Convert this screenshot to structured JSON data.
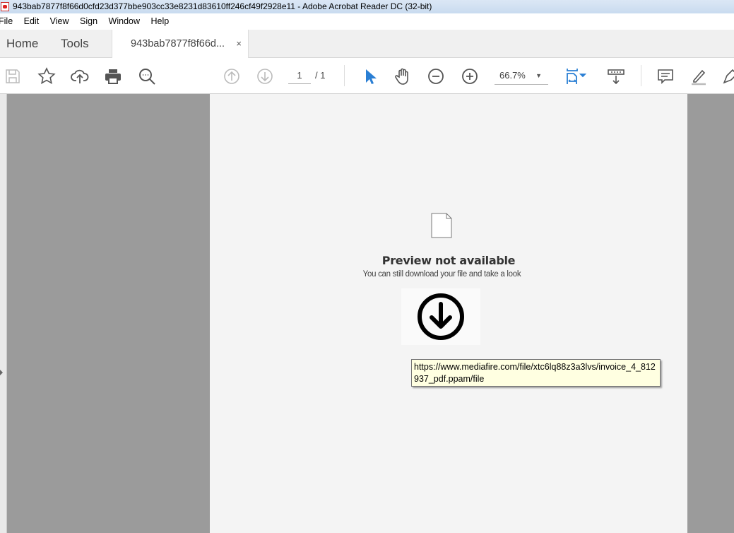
{
  "window": {
    "title": "943bab7877f8f66d0cfd23d377bbe903cc33e8231d83610ff246cf49f2928e11 - Adobe Acrobat Reader DC (32-bit)"
  },
  "menu": [
    "File",
    "Edit",
    "View",
    "Sign",
    "Window",
    "Help"
  ],
  "tabs": {
    "home": "Home",
    "tools": "Tools",
    "document": "943bab7877f8f66d...",
    "close": "×"
  },
  "toolbar": {
    "page_current": "1",
    "page_total": "/ 1",
    "zoom": "66.7%",
    "zoom_caret": "▼",
    "accent": "#2a7fd4"
  },
  "document": {
    "preview_title": "Preview not available",
    "preview_subtitle": "You can still download your file and take a look"
  },
  "tooltip": {
    "text": "https://www.mediafire.com/file/xtc6lq88z3a3lvs/invoice_4_812937_pdf.ppam/file"
  }
}
